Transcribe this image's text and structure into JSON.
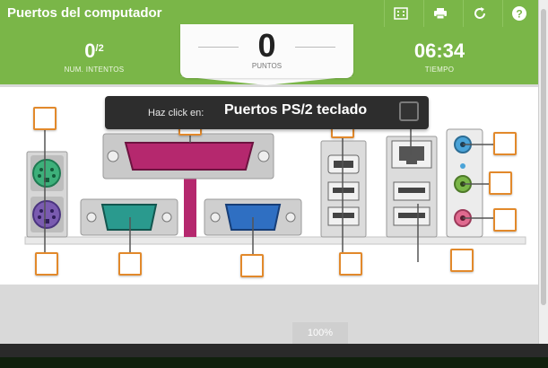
{
  "header": {
    "title": "Puertos del computador",
    "buttons": [
      {
        "name": "fullscreen-button",
        "icon": "fullscreen-icon"
      },
      {
        "name": "print-button",
        "icon": "print-icon"
      },
      {
        "name": "restart-button",
        "icon": "restart-icon"
      },
      {
        "name": "help-button",
        "icon": "help-icon"
      }
    ]
  },
  "scoreboard": {
    "attempts_value": "0",
    "attempts_total": "/2",
    "attempts_label": "NUM. INTENTOS",
    "points_value": "0",
    "points_label": "PUNTOS",
    "time_value": "06:34",
    "time_label": "TIEMPO"
  },
  "prompt": {
    "label": "Haz click en:",
    "target": "Puertos PS/2 teclado"
  },
  "zoom": "100%",
  "colors": {
    "brand_green": "#7ab648",
    "drop_border": "#e2892b",
    "prompt_bg": "#2d2d2d",
    "parallel_port": "#b5286e",
    "serial_port": "#2a9a8e",
    "vga_port": "#2f6fc2",
    "ps2_mouse": "#3db07a",
    "ps2_keyboard": "#7a5bb0",
    "audio_blue": "#4aa3d8",
    "audio_green": "#7ab648",
    "audio_pink": "#e06a8f"
  }
}
